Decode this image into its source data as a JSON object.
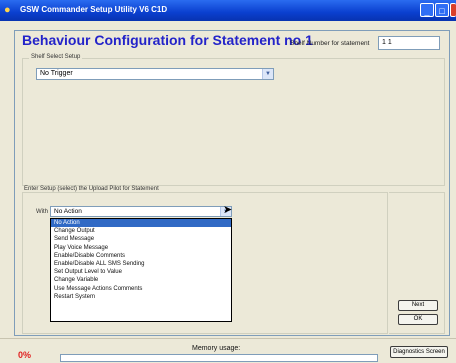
{
  "window": {
    "title": "GSW Commander Setup Utility V6 C1D",
    "controls": [
      "_",
      "□",
      "×"
    ]
  },
  "header": {
    "heading": "Behaviour Configuration for Statement no 1",
    "shelf_label": "Shelf Number for statement",
    "shelf_value": "1 1"
  },
  "group1": {
    "label": "Shelf Select Setup",
    "combo_value": "No Trigger"
  },
  "group2": {
    "label": "Enter Setup (select) the Upload Pilot for Statement",
    "field_label": "With",
    "combo_value": "No Action",
    "options": [
      "No Action",
      "Change Output",
      "Send Message",
      "Play Voice Message",
      "Enable/Disable Comments",
      "Enable/Disable ALL SMS Sending",
      "Set Output Level to Value",
      "Change Variable",
      "Use Message Actions Comments",
      "Restart System"
    ],
    "selected_index": 0
  },
  "buttons": {
    "next": "Next",
    "ok": "OK",
    "debug": "Diagnostics Screen"
  },
  "status": {
    "percent": "0%",
    "memory_label": "Memory usage:"
  }
}
